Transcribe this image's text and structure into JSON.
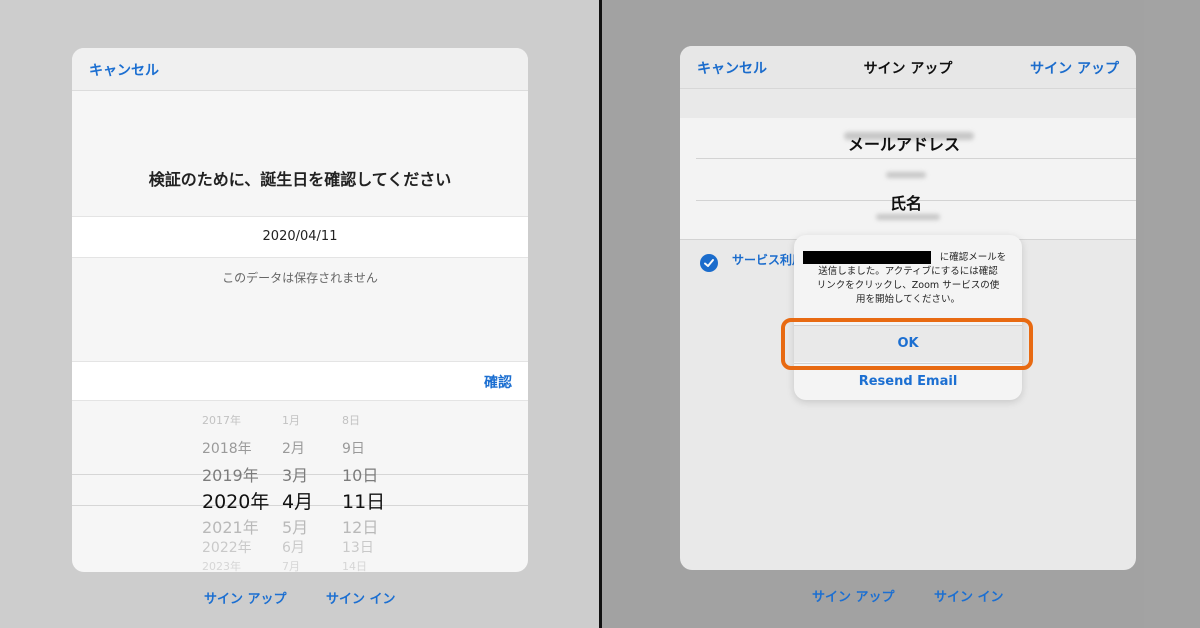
{
  "left": {
    "nav": {
      "cancel_label": "キャンセル"
    },
    "headline": "検証のために、誕生日を確認してください",
    "date_value": "2020/04/11",
    "note": "このデータは保存されません",
    "confirm_label": "確認",
    "picker": {
      "years": [
        "2017年",
        "2018年",
        "2019年",
        "2020年",
        "2021年",
        "2022年",
        "2023年"
      ],
      "months": [
        "1月",
        "2月",
        "3月",
        "4月",
        "5月",
        "6月",
        "7月"
      ],
      "days": [
        "8日",
        "9日",
        "10日",
        "11日",
        "12日",
        "13日",
        "14日"
      ],
      "selected": {
        "year": "2020年",
        "month": "4月",
        "day": "11日"
      }
    },
    "footer": {
      "sign_up": "サイン アップ",
      "sign_in": "サイン イン"
    }
  },
  "right": {
    "nav": {
      "cancel_label": "キャンセル",
      "title": "サイン アップ",
      "action_label": "サイン アップ"
    },
    "fields": {
      "email_label": "メールアドレス",
      "name_label": "氏名"
    },
    "terms_text": "サービス利用",
    "alert": {
      "message_line1": "に確認メールを",
      "message_line2": "送信しました。アクティブにするには確認",
      "message_line3": "リンクをクリックし、Zoom サービスの使",
      "message_line4": "用を開始してください。",
      "ok_label": "OK",
      "resend_label": "Resend Email"
    },
    "footer": {
      "sign_up": "サイン アップ",
      "sign_in": "サイン イン"
    }
  },
  "colors": {
    "accent": "#1c6fd1",
    "highlight": "#e86a12"
  }
}
